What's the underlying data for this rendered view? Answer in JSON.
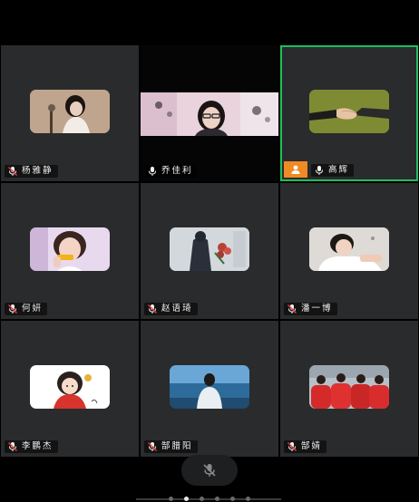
{
  "participants": [
    {
      "name": "杨雅静",
      "mic": "muted",
      "thumb": "portrait-woman-dark",
      "active": false,
      "host": false,
      "video": false
    },
    {
      "name": "乔佳利",
      "mic": "on",
      "thumb": "webcam-girl-glasses",
      "active": false,
      "host": false,
      "video": true
    },
    {
      "name": "高辉",
      "mic": "on",
      "thumb": "handshake",
      "active": true,
      "host": true,
      "video": false
    },
    {
      "name": "何妍",
      "mic": "muted",
      "thumb": "girl-eating",
      "active": false,
      "host": false,
      "video": false
    },
    {
      "name": "赵语琦",
      "mic": "muted",
      "thumb": "person-with-flowers",
      "active": false,
      "host": false,
      "video": false
    },
    {
      "name": "潘一博",
      "mic": "muted",
      "thumb": "boy-lying",
      "active": false,
      "host": false,
      "video": false
    },
    {
      "name": "李鹏杰",
      "mic": "muted",
      "thumb": "cartoon-girl",
      "active": false,
      "host": false,
      "video": false
    },
    {
      "name": "郜腊阳",
      "mic": "muted",
      "thumb": "boy-by-sea",
      "active": false,
      "host": false,
      "video": false
    },
    {
      "name": "郜婧",
      "mic": "muted",
      "thumb": "team-red",
      "active": false,
      "host": false,
      "video": false
    }
  ],
  "toolbar": {
    "mute_icon": "mic-off-icon"
  },
  "pagination": {
    "total": 6,
    "current": 2
  },
  "colors": {
    "active_border": "#1fbf5b",
    "host_badge": "#f08a24",
    "tile_bg": "#2a2b2d"
  }
}
